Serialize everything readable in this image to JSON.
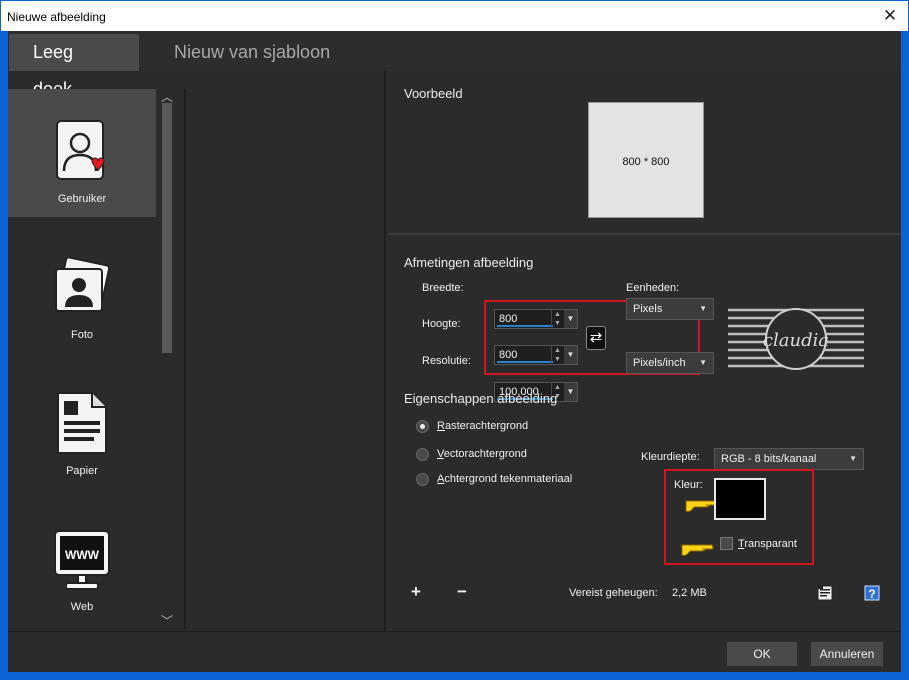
{
  "window": {
    "title": "Nieuwe afbeelding",
    "close_glyph": "✕"
  },
  "tabs": [
    {
      "label": "Leeg doek"
    },
    {
      "label": "Nieuw van sjabloon"
    }
  ],
  "categories": [
    {
      "label": "Gebruiker",
      "icon": "user-icon"
    },
    {
      "label": "Foto",
      "icon": "photo-icon"
    },
    {
      "label": "Papier",
      "icon": "paper-icon"
    },
    {
      "label": "Web",
      "icon": "web-icon"
    }
  ],
  "web_icon_text": "WWW",
  "preview": {
    "title": "Voorbeeld",
    "text": "800 * 800"
  },
  "dimensions": {
    "title": "Afmetingen afbeelding",
    "width_label": "Breedte:",
    "width_value": "800",
    "height_label": "Hoogte:",
    "height_value": "800",
    "resolution_label": "Resolutie:",
    "resolution_value": "100,000",
    "units_label": "Eenheden:",
    "units_value": "Pixels",
    "res_units_value": "Pixels/inch"
  },
  "properties": {
    "title": "Eigenschappen afbeelding",
    "raster": {
      "first": "R",
      "rest": "asterachtergrond"
    },
    "vector": {
      "first": "V",
      "rest": "ectorachtergrond"
    },
    "material": {
      "first": "A",
      "rest": "chtergrond tekenmateriaal"
    },
    "depth_label": "Kleurdiepte:",
    "depth_value": "RGB - 8 bits/kanaal",
    "color_label": "Kleur:",
    "transparent": {
      "first": "T",
      "rest": "ransparant"
    }
  },
  "memory": {
    "label": "Vereist geheugen:",
    "value": "2,2 MB"
  },
  "watermark_text": "claudia",
  "buttons": {
    "ok": "OK",
    "cancel": "Annuleren"
  },
  "colors": {
    "accent": "#d0161f",
    "highlight": "#2a7fd0",
    "pointer": "#ffd21a"
  }
}
